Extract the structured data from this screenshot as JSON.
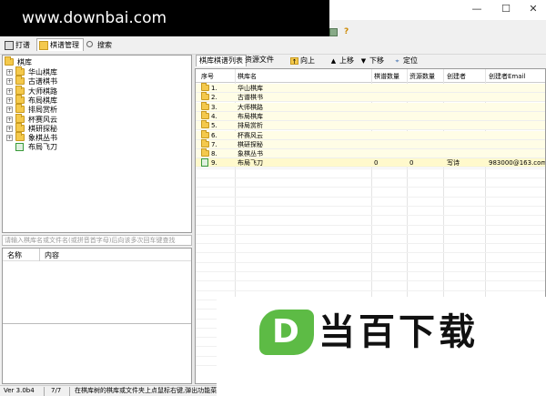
{
  "watermark": {
    "text": "www.downbai.com"
  },
  "window_controls": {
    "minimize": "—",
    "maximize": "☐",
    "close": "✕"
  },
  "menu": {
    "tabs": [
      {
        "label": "打谱",
        "icon": "board-icon"
      },
      {
        "label": "棋谱管理",
        "icon": "folder-icon"
      },
      {
        "label": "搜索",
        "icon": "search-icon"
      }
    ],
    "help_icon": "?"
  },
  "tree": {
    "root": "棋库",
    "items": [
      {
        "label": "华山棋库",
        "type": "folder"
      },
      {
        "label": "古谱棋书",
        "type": "folder"
      },
      {
        "label": "大师棋路",
        "type": "folder"
      },
      {
        "label": "布局棋库",
        "type": "folder"
      },
      {
        "label": "排局赏析",
        "type": "folder"
      },
      {
        "label": "杯赛风云",
        "type": "folder"
      },
      {
        "label": "棋研探秘",
        "type": "folder"
      },
      {
        "label": "象棋丛书",
        "type": "folder"
      },
      {
        "label": "布局飞刀",
        "type": "book"
      }
    ]
  },
  "search": {
    "placeholder": "请输入棋库名或文件名(或拼音首字母)后向该多次回车键查找"
  },
  "props": {
    "col_name": "名称",
    "col_content": "内容"
  },
  "status": {
    "version": "Ver 3.0b4",
    "count": "7/7",
    "hint": "在棋库树的棋库或文件夹上点鼠标右键,弹出功能菜..."
  },
  "right": {
    "tabs": [
      "棋库棋谱列表",
      "资源文件"
    ],
    "buttons": [
      {
        "label": "向上",
        "icon": "up-folder-icon"
      },
      {
        "label": "上移",
        "icon": "arrow-up-icon"
      },
      {
        "label": "下移",
        "icon": "arrow-down-icon"
      },
      {
        "label": "定位",
        "icon": "locate-icon"
      }
    ],
    "columns": [
      "序号",
      "棋库名",
      "棋谱数量",
      "资源数量",
      "创建者",
      "创建者Email"
    ],
    "rows": [
      {
        "idx": "1.",
        "name": "华山棋库",
        "type": "folder"
      },
      {
        "idx": "2.",
        "name": "古谱棋书",
        "type": "folder"
      },
      {
        "idx": "3.",
        "name": "大师棋路",
        "type": "folder"
      },
      {
        "idx": "4.",
        "name": "布局棋库",
        "type": "folder"
      },
      {
        "idx": "5.",
        "name": "排局赏析",
        "type": "folder"
      },
      {
        "idx": "6.",
        "name": "杯赛风云",
        "type": "folder"
      },
      {
        "idx": "7.",
        "name": "棋研探秘",
        "type": "folder"
      },
      {
        "idx": "8.",
        "name": "象棋丛书",
        "type": "folder"
      },
      {
        "idx": "9.",
        "name": "布局飞刀",
        "type": "book",
        "count": "0",
        "res": "0",
        "creator": "写诗",
        "email": "983000@163.com"
      }
    ]
  },
  "logo": {
    "mark": "D",
    "text": "当百下载"
  }
}
